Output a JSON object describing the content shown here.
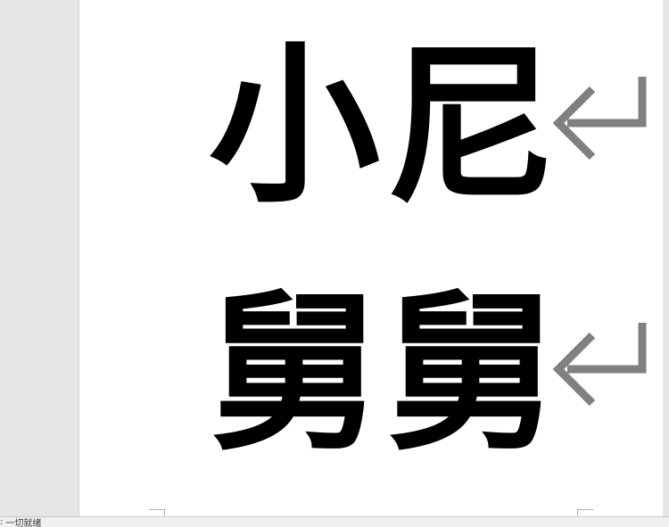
{
  "document": {
    "lines": [
      {
        "text": "小尼"
      },
      {
        "text": "舅舅"
      }
    ]
  },
  "icons": {
    "paragraph_mark": "return-arrow-icon",
    "corner_mark": "page-corner-icon"
  },
  "status_bar": {
    "prefix": ":",
    "text": "一切就绪"
  },
  "colors": {
    "workspace": "#e6e6e6",
    "page": "#ffffff",
    "text": "#000000",
    "paragraph_mark": "#808080"
  }
}
